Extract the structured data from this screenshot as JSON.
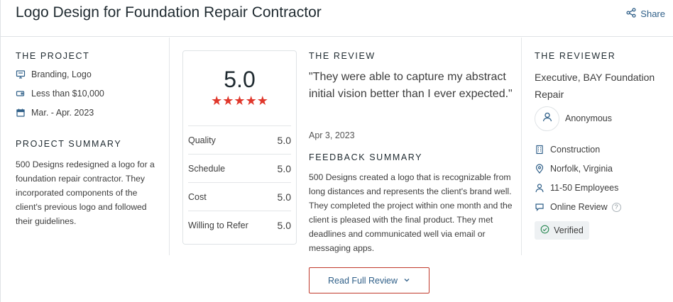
{
  "header": {
    "title": "Logo Design for Foundation Repair Contractor",
    "share_label": "Share"
  },
  "project": {
    "section_label": "THE PROJECT",
    "items": [
      {
        "icon": "monitor-icon",
        "text": "Branding, Logo"
      },
      {
        "icon": "price-tag-icon",
        "text": "Less than $10,000"
      },
      {
        "icon": "calendar-icon",
        "text": "Mar. - Apr. 2023"
      }
    ],
    "summary_label": "PROJECT SUMMARY",
    "summary_text": "500 Designs redesigned a logo for a foundation repair contractor. They incorporated components of the client's previous logo and followed their guidelines."
  },
  "scores": {
    "overall": "5.0",
    "stars": "★★★★★",
    "rows": [
      {
        "label": "Quality",
        "value": "5.0"
      },
      {
        "label": "Schedule",
        "value": "5.0"
      },
      {
        "label": "Cost",
        "value": "5.0"
      },
      {
        "label": "Willing to Refer",
        "value": "5.0"
      }
    ]
  },
  "review": {
    "section_label": "THE REVIEW",
    "quote": "\"They were able to capture my abstract initial vision better than I ever expected.\"",
    "date": "Apr 3, 2023",
    "feedback_label": "FEEDBACK SUMMARY",
    "feedback_text": "500 Designs created a logo that is recognizable from long distances and represents the client's brand well. They completed the project within one month and the client is pleased with the final product. They met deadlines and communicated well via email or messaging apps.",
    "read_button_label": "Read Full Review"
  },
  "reviewer": {
    "section_label": "THE REVIEWER",
    "title": "Executive, BAY Foundation Repair",
    "name": "Anonymous",
    "industry": "Construction",
    "location": "Norfolk, Virginia",
    "employees": "11-50 Employees",
    "review_type": "Online Review",
    "help_glyph": "?",
    "verified_label": "Verified"
  },
  "colors": {
    "accent_red": "#e0372b",
    "link_blue": "#2f5f88",
    "button_border": "#c0392b"
  }
}
